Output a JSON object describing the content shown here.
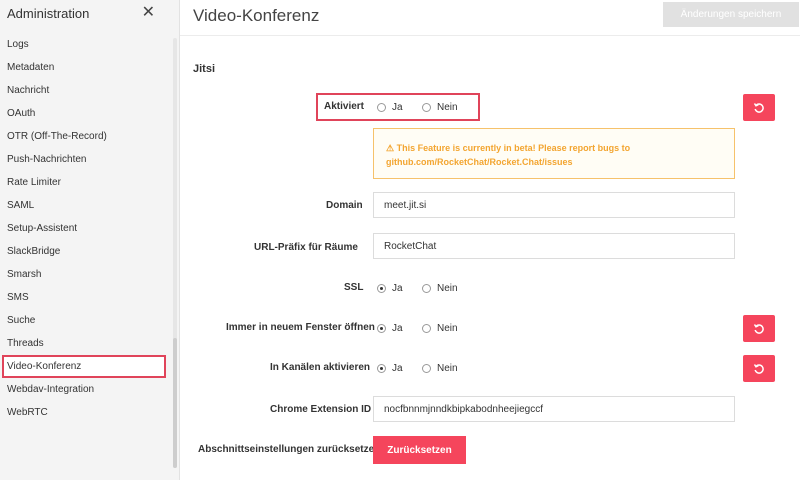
{
  "sidebar": {
    "title": "Administration",
    "close_icon": "close-icon",
    "items": [
      {
        "label": "Logs"
      },
      {
        "label": "Metadaten"
      },
      {
        "label": "Nachricht"
      },
      {
        "label": "OAuth"
      },
      {
        "label": "OTR (Off-The-Record)"
      },
      {
        "label": "Push-Nachrichten"
      },
      {
        "label": "Rate Limiter"
      },
      {
        "label": "SAML"
      },
      {
        "label": "Setup-Assistent"
      },
      {
        "label": "SlackBridge"
      },
      {
        "label": "Smarsh"
      },
      {
        "label": "SMS"
      },
      {
        "label": "Suche"
      },
      {
        "label": "Threads"
      },
      {
        "label": "Video-Konferenz"
      },
      {
        "label": "Webdav-Integration"
      },
      {
        "label": "WebRTC"
      }
    ],
    "active_item": "Video-Konferenz"
  },
  "main": {
    "title": "Video-Konferenz",
    "save_label": "Änderungen speichern",
    "section": "Jitsi",
    "settings": {
      "enabled": {
        "label": "Aktiviert",
        "yes": "Ja",
        "no": "Nein",
        "value": "Nein"
      },
      "beta_notice": "⚠ This Feature is currently in beta! Please report bugs to github.com/RocketChat/Rocket.Chat/issues",
      "domain": {
        "label": "Domain",
        "value": "meet.jit.si"
      },
      "url_prefix": {
        "label": "URL-Präfix für Räume",
        "value": "RocketChat"
      },
      "ssl": {
        "label": "SSL",
        "yes": "Ja",
        "no": "Nein",
        "value": "Ja"
      },
      "new_window": {
        "label": "Immer in neuem Fenster öffnen",
        "yes": "Ja",
        "no": "Nein",
        "value": "Ja"
      },
      "channels": {
        "label": "In Kanälen aktivieren",
        "yes": "Ja",
        "no": "Nein",
        "value": "Ja"
      },
      "chrome_ext": {
        "label": "Chrome Extension ID",
        "value": "nocfbnnmjnndkbipkabodnheejiegccf"
      },
      "reset_section": {
        "label": "Abschnittseinstellungen zurücksetzen",
        "button": "Zurücksetzen"
      }
    }
  },
  "colors": {
    "accent": "#f5455c",
    "highlight": "#e0445a",
    "warning": "#f3a530"
  }
}
